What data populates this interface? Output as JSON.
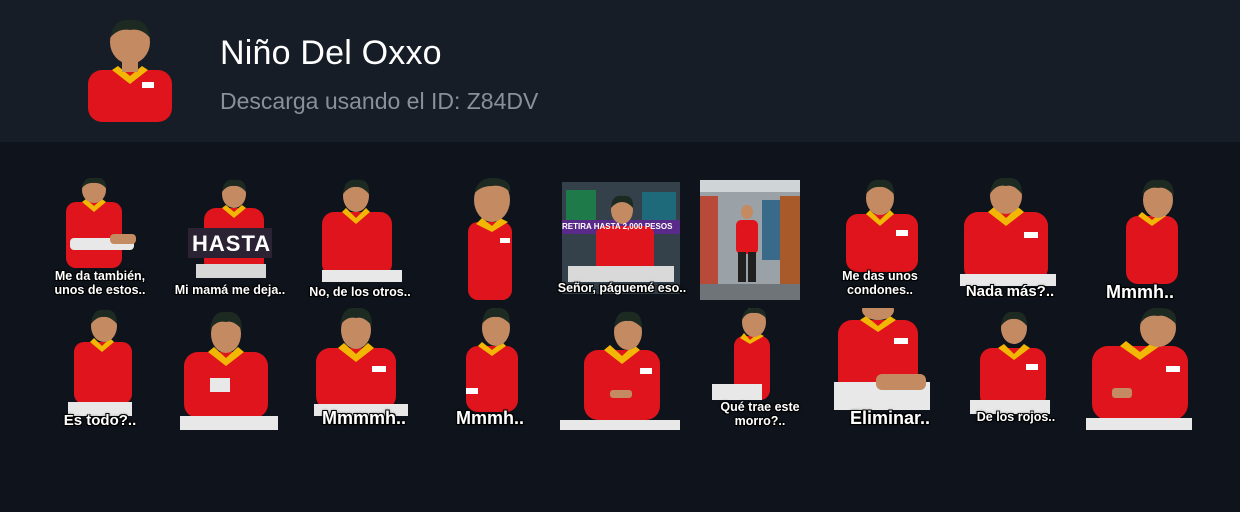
{
  "pack": {
    "title": "Niño Del Oxxo",
    "subtitle": "Descarga usando el ID: Z84DV"
  },
  "colors": {
    "header_bg": "#171d26",
    "page_bg": "#0f141c",
    "shirt_red": "#e0141c",
    "collar_yellow": "#f2b705",
    "skin": "#c48a62",
    "hair": "#1c2a22"
  },
  "banner_text": "HASTA",
  "sign_text": "RETIRA HASTA 2,000 PESOS",
  "stickers": [
    {
      "caption": "Me da también,\nunos de estos.."
    },
    {
      "caption": "Mi mamá me deja.."
    },
    {
      "caption": "No, de los otros.."
    },
    {
      "caption": ""
    },
    {
      "caption": "Señor, páguemé eso.."
    },
    {
      "caption": ""
    },
    {
      "caption": "Me das unos\ncondones.."
    },
    {
      "caption": "Nada más?.."
    },
    {
      "caption": "Mmmh.."
    },
    {
      "caption": "Es todo?.."
    },
    {
      "caption": ""
    },
    {
      "caption": "Mmmmh.."
    },
    {
      "caption": "Mmmh.."
    },
    {
      "caption": ""
    },
    {
      "caption": "Qué trae este\nmorro?.."
    },
    {
      "caption": "Eliminar.."
    },
    {
      "caption": "De los rojos.."
    },
    {
      "caption": ""
    }
  ]
}
